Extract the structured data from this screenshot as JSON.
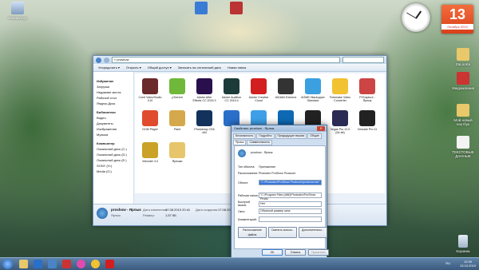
{
  "desktop": {
    "icons": [
      {
        "label": "Компьютер",
        "color": "#8da9c8"
      },
      {
        "label": "",
        "color": "#3a7bd5"
      },
      {
        "label": "",
        "color": "#b33"
      }
    ],
    "right_icons": [
      {
        "label": "ZaLooKa"
      },
      {
        "label": "Уведомления"
      },
      {
        "label": "Мой новый ноутбук"
      },
      {
        "label": "ТЕКСТОВЫЕ ДАННЫЕ"
      },
      {
        "label": "Корзина"
      }
    ]
  },
  "calendar": {
    "day": "13",
    "month": "Октябрь 2019"
  },
  "explorer": {
    "address": "« proshow",
    "toolbar": [
      "Упорядочить ▾",
      "Открыть ▾",
      "Общий доступ ▾",
      "Записать на оптический диск",
      "Новая папка"
    ],
    "nav": [
      {
        "label": "Избранное",
        "header": true
      },
      {
        "label": "Загрузки"
      },
      {
        "label": "Недавние места"
      },
      {
        "label": "Рабочий стол"
      },
      {
        "label": "Яндекс.Диск"
      },
      {
        "label": "Библиотеки",
        "header": true
      },
      {
        "label": "Видео"
      },
      {
        "label": "Документы"
      },
      {
        "label": "Изображения"
      },
      {
        "label": "Музыка"
      },
      {
        "label": "Компьютер",
        "header": true
      },
      {
        "label": "Локальный диск (C:)"
      },
      {
        "label": "Локальный диск (D:)"
      },
      {
        "label": "Локальный диск (E:)"
      },
      {
        "label": "SONY (H:)"
      },
      {
        "label": "Media (G:)"
      }
    ],
    "files": [
      {
        "label": "Corel VideoStudio X10",
        "color": "#6b2a2a"
      },
      {
        "label": "µTorrent",
        "color": "#6fb83a"
      },
      {
        "label": "Adobe After Effects CC 2015.3",
        "color": "#2a0f4d"
      },
      {
        "label": "Adobe Audition CC 2015.4",
        "color": "#1d3b39"
      },
      {
        "label": "Adobe Creative Cloud",
        "color": "#d21e1e"
      },
      {
        "label": "AIDA64 Extreme",
        "color": "#333"
      },
      {
        "label": "AOMEI Backupper Standard",
        "color": "#3aa0e0"
      },
      {
        "label": "Freemake Video Converter",
        "color": "#f1c232"
      },
      {
        "label": "FSCapture - Ярлык",
        "color": "#c44"
      },
      {
        "label": "GOM Player",
        "color": "#e04b2e"
      },
      {
        "label": "Paint",
        "color": "#d5a94b"
      },
      {
        "label": "Photoshop CS6 x64",
        "color": "#12325c"
      },
      {
        "label": "",
        "color": "#2a6fc9"
      },
      {
        "label": "",
        "color": "#3ea0e8"
      },
      {
        "label": "TeamViewer 14",
        "color": "#0e6ab4"
      },
      {
        "label": "Vegas Pro 10.0",
        "color": "#222"
      },
      {
        "label": "Vegas Pro 12.0 (64-bit)",
        "color": "#2a2a55"
      },
      {
        "label": "Vmware Pro 11",
        "color": "#222"
      },
      {
        "label": "Vidcoder 3.0",
        "color": "#c9a227"
      },
      {
        "label": "Ярлыки",
        "color": "#e7c56a"
      }
    ],
    "status": {
      "name": "proshow - Ярлык",
      "modified_label": "Дата изменения:",
      "modified": "17.08.2019 20:41",
      "type": "Ярлык",
      "size_label": "Размер:",
      "size": "1,57 КБ",
      "created_label": "Дата создания:",
      "created": "17.08.2019 20:41"
    }
  },
  "dialog": {
    "title": "Свойства: proshow - Ярлык",
    "close": "✕",
    "tabs": [
      "Безопасность",
      "Подробно",
      "Предыдущие версии",
      "Общие",
      "Ярлык",
      "Совместимость"
    ],
    "active_tab": "Ярлык",
    "name": "proshow - Ярлык",
    "fields": [
      {
        "label": "Тип объекта:",
        "value": "Приложение"
      },
      {
        "label": "Расположение:",
        "value": "Photodex ProShow Producer"
      },
      {
        "label": "Объект:",
        "value": "\"C:\\Photodex\\ProShow Producer\\proshow.exe\"",
        "selected": true
      },
      {
        "label": "Рабочая папка:",
        "value": "\"C:\\Program Files (x86)\\Photodex\\ProShow Produ"
      },
      {
        "label": "Быстрый вызов:",
        "value": "Нет"
      },
      {
        "label": "Окно:",
        "value": "Обычный размер окна"
      },
      {
        "label": "Комментарий:",
        "value": ""
      }
    ],
    "buttons_row": [
      "Расположение файла",
      "Сменить значок...",
      "Дополнительно..."
    ],
    "ok": "ОК",
    "cancel": "Отмена",
    "apply": "Применить"
  },
  "taskbar": {
    "time": "12:39",
    "date": "13.10.2019",
    "lang": "RU"
  },
  "colors": {
    "selection": "#3875d7",
    "taskbar": "#3a5a7e"
  }
}
